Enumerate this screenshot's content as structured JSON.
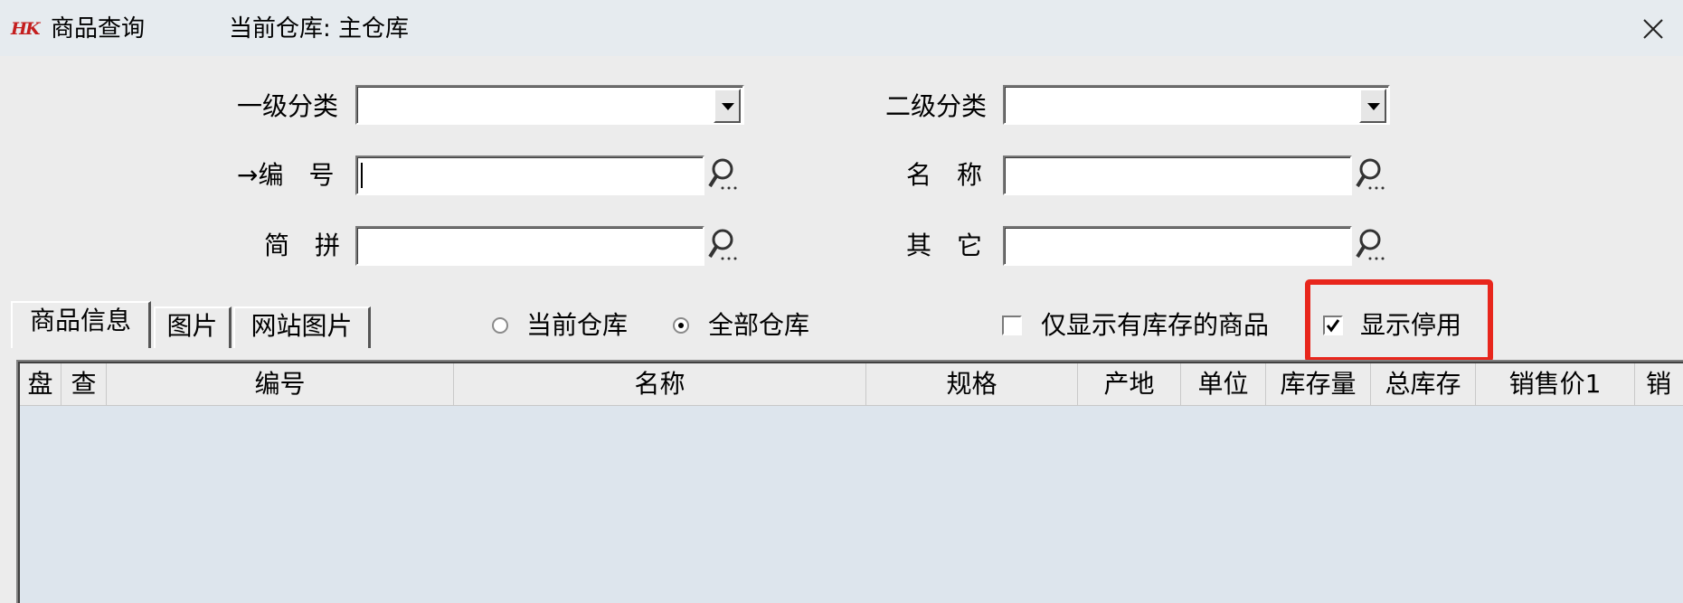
{
  "window": {
    "logo_text": "HK",
    "title": "商品查询",
    "warehouse_label": "当前仓库: 主仓库",
    "close_symbol": "✕"
  },
  "filters": {
    "category1_label": "一级分类",
    "category1_value": "",
    "category2_label": "二级分类",
    "category2_value": "",
    "code_label": "→编　号",
    "code_value": "",
    "name_label": "名　称",
    "name_value": "",
    "pinyin_label": "简　拼",
    "pinyin_value": "",
    "other_label": "其　它",
    "other_value": ""
  },
  "tabs": [
    {
      "label": "商品信息",
      "active": true
    },
    {
      "label": "图片",
      "active": false
    },
    {
      "label": "网站图片",
      "active": false
    }
  ],
  "warehouse_scope": {
    "options": [
      "当前仓库",
      "全部仓库"
    ],
    "selected": "全部仓库"
  },
  "options": {
    "only_in_stock_label": "仅显示有库存的商品",
    "only_in_stock_checked": false,
    "show_disabled_label": "显示停用",
    "show_disabled_checked": true,
    "highlight_color": "#e8261c"
  },
  "grid": {
    "columns": [
      "盘",
      "查",
      "编号",
      "名称",
      "规格",
      "产地",
      "单位",
      "库存量",
      "总库存",
      "销售价1",
      "销"
    ],
    "rows": [],
    "empty_background": "#dde5ed"
  }
}
